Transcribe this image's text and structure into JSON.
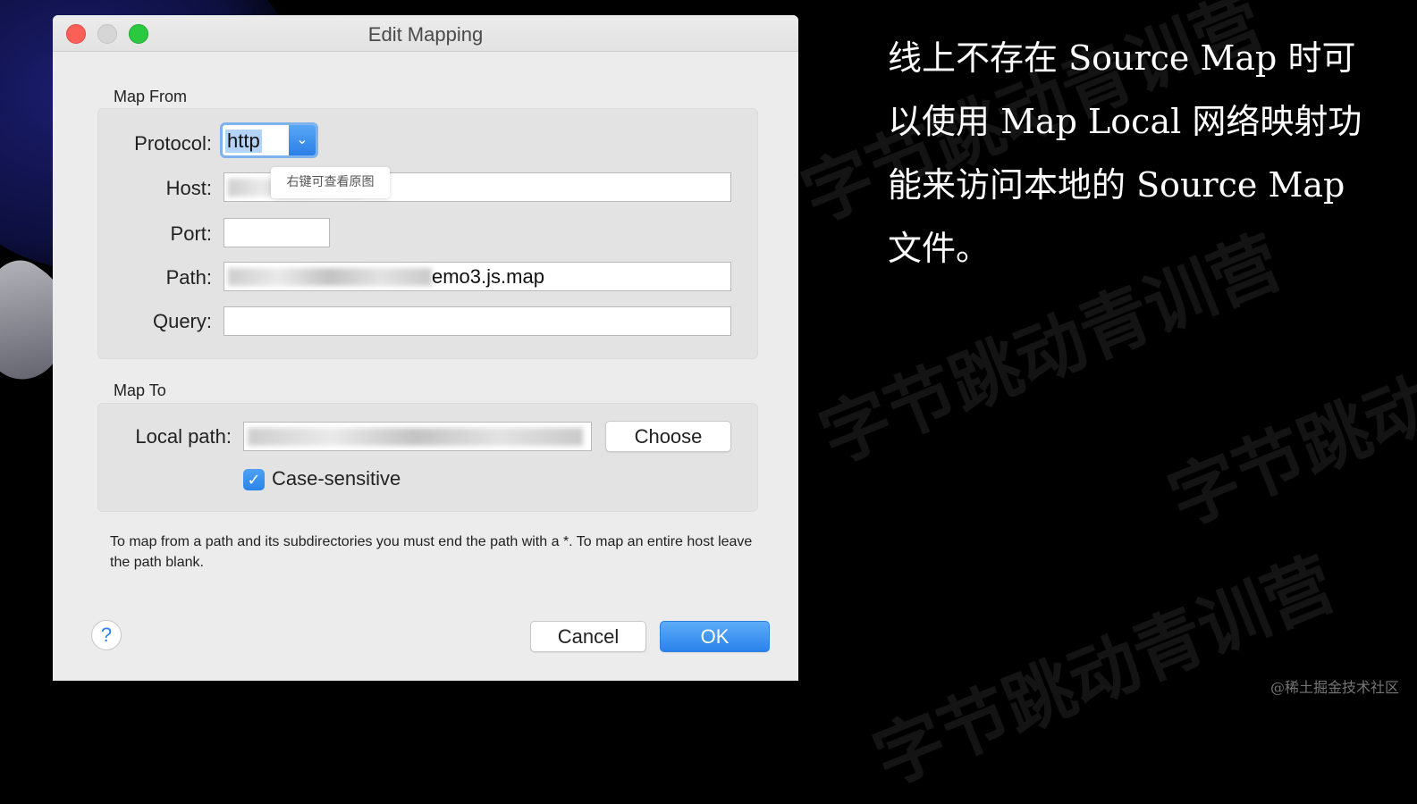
{
  "window": {
    "title": "Edit Mapping"
  },
  "map_from": {
    "section_label": "Map From",
    "protocol": {
      "label": "Protocol:",
      "value": "http"
    },
    "host": {
      "label": "Host:",
      "value": ""
    },
    "port": {
      "label": "Port:",
      "value": ""
    },
    "path": {
      "label": "Path:",
      "value_visible": "emo3.js.map"
    },
    "query": {
      "label": "Query:",
      "value": ""
    }
  },
  "tooltip": {
    "text": "右键可查看原图"
  },
  "map_to": {
    "section_label": "Map To",
    "local_path": {
      "label": "Local path:",
      "value": ""
    },
    "choose_button": "Choose",
    "case_sensitive": {
      "label": "Case-sensitive",
      "checked": true
    }
  },
  "hint_text": "To map from a path and its subdirectories you must end the path with a *. To map an entire host leave the path blank.",
  "buttons": {
    "help": "?",
    "cancel": "Cancel",
    "ok": "OK"
  },
  "caption": "线上不存在 Source Map 时可以使用 Map Local 网络映射功能来访问本地的 Source Map 文件。",
  "attribution": "@稀土掘金技术社区",
  "watermark_text": "字节跳动青训营",
  "colors": {
    "accent": "#2a82ec",
    "close": "#fc5f57",
    "zoom": "#2ac940"
  }
}
